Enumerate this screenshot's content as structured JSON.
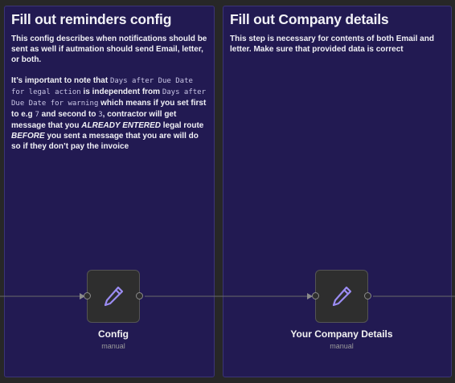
{
  "notes": {
    "left": {
      "title": "Fill out reminders config",
      "para1": "This config describes when notifications should be sent as well if autmation should send Email, letter, or both.",
      "para2": {
        "t1": "It’s important to note that ",
        "code1": "Days after Due Date for legal action",
        "t2": " is independent from ",
        "code2": "Days after Due Date for warning",
        "t3": " which means if you set first to e.g ",
        "code3": "7",
        "t4": " and second to ",
        "code4": "3",
        "t5": ", contractor will get message that you ",
        "em1": "ALREADY ENTERED",
        "t6": " legal route ",
        "em2": "BEFORE",
        "t7": " you sent a message that you are will do so if they don’t pay the invoice"
      }
    },
    "right": {
      "title": "Fill out Company details",
      "para1": "This step is necessary for contents of both Email and letter. Make sure that provided data is correct"
    }
  },
  "nodes": [
    {
      "title": "Config",
      "subtitle": "manual",
      "icon": "pencil-icon"
    },
    {
      "title": "Your Company Details",
      "subtitle": "manual",
      "icon": "pencil-icon"
    }
  ],
  "colors": {
    "canvas": "#272727",
    "sticky_note": "#221a52",
    "node_bg": "#2e2e2e",
    "icon_accent": "#9b8cf2",
    "edge": "#6a6a6a"
  }
}
